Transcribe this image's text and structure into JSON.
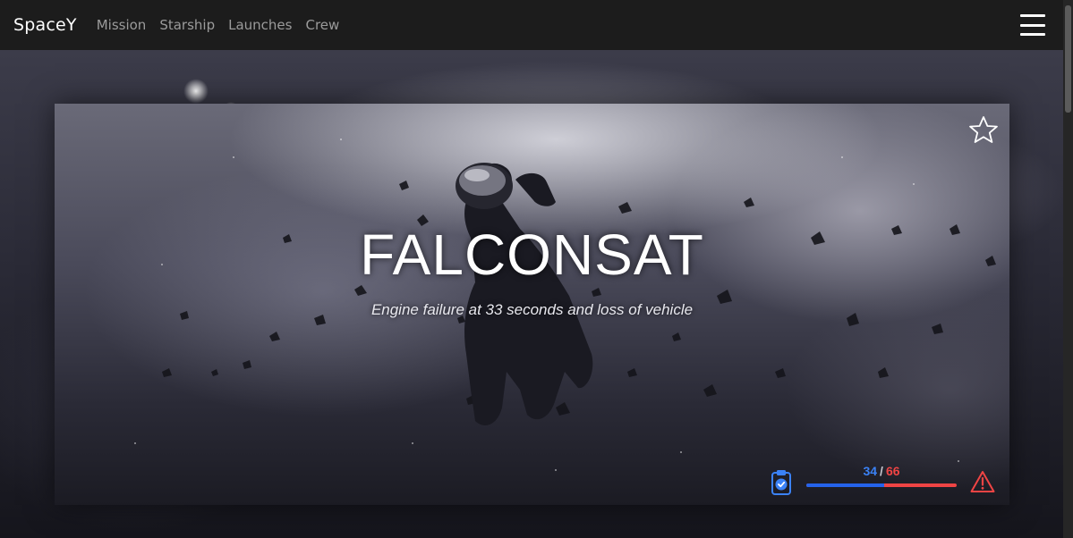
{
  "nav": {
    "brand": "SpaceY",
    "links": [
      "Mission",
      "Starship",
      "Launches",
      "Crew"
    ],
    "menu_icon": "hamburger-menu-icon"
  },
  "card": {
    "title": "FALCONSAT",
    "subtitle": "Engine failure at 33 seconds and loss of vehicle",
    "favorite_icon": "star-outline-icon",
    "status_icon": "clipboard-check-icon",
    "warning_icon": "warning-triangle-icon",
    "progress": {
      "done": "34",
      "separator": "/",
      "total": "66",
      "fraction": 0.515
    }
  },
  "colors": {
    "done": "#3b82f6",
    "total": "#ef4444",
    "navbar": "#1c1c1c"
  }
}
